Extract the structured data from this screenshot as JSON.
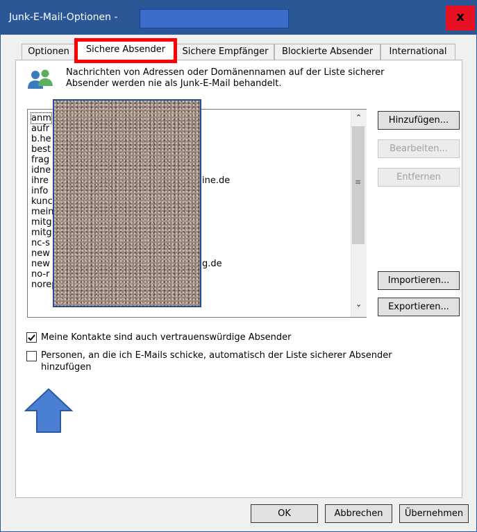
{
  "window": {
    "title": "Junk-E-Mail-Optionen -",
    "close_glyph": "x"
  },
  "tabs": [
    {
      "label": "Optionen",
      "active": false
    },
    {
      "label": "Sichere Absender",
      "active": true
    },
    {
      "label": "Sichere Empfänger",
      "active": false
    },
    {
      "label": "Blockierte Absender",
      "active": false
    },
    {
      "label": "International",
      "active": false
    }
  ],
  "info": {
    "icon": "contacts-icon",
    "text": "Nachrichten von Adressen oder Domänennamen auf der Liste sicherer Absender werden nie als Junk-E-Mail behandelt."
  },
  "list": {
    "items": [
      "anm",
      "aufr",
      "b.he",
      "best",
      "frag",
      "idne",
      "ihre",
      "info",
      "kunc",
      "mein",
      "mitg",
      "mitg",
      "nc-s",
      "new",
      "new",
      "no-r",
      "noreply@md.de"
    ],
    "partial_suffixes": [
      "ine.de",
      "g.de"
    ]
  },
  "buttons": {
    "add": "Hinzufügen...",
    "edit": "Bearbeiten...",
    "remove": "Entfernen",
    "import": "Importieren...",
    "export": "Exportieren...",
    "ok": "OK",
    "cancel": "Abbrechen",
    "apply": "Übernehmen"
  },
  "checkboxes": {
    "contacts": {
      "label": "Meine Kontakte sind auch vertrauenswürdige Absender",
      "checked": true
    },
    "auto_add": {
      "label_line1": "Personen, an die ich E-Mails schicke, automatisch der Liste sicherer Absender",
      "label_line2": "hinzufügen",
      "checked": false
    }
  },
  "colors": {
    "titlebar": "#2b5797",
    "highlight": "#ff0000",
    "arrow": "#4a7fd4"
  }
}
